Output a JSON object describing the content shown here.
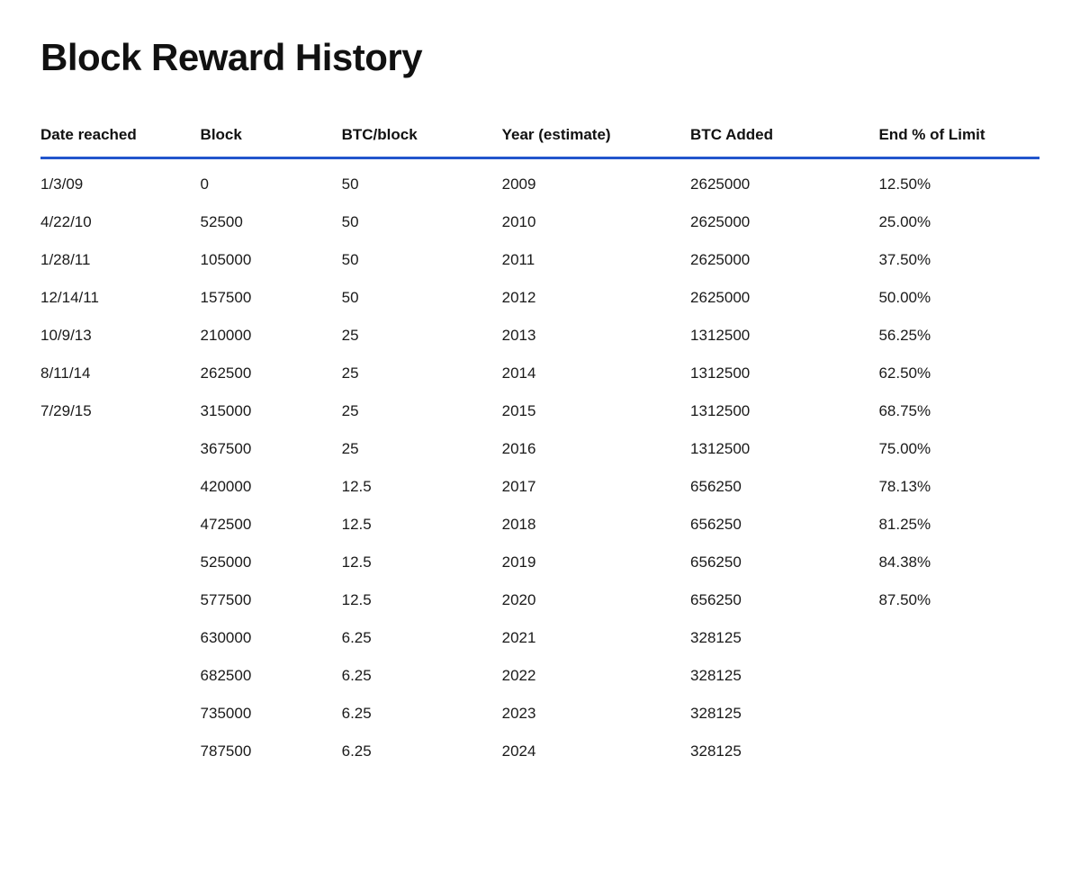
{
  "title": "Block Reward History",
  "table": {
    "headers": [
      {
        "key": "date",
        "label": "Date reached"
      },
      {
        "key": "block",
        "label": "Block"
      },
      {
        "key": "btcblock",
        "label": "BTC/block"
      },
      {
        "key": "year",
        "label": "Year (estimate)"
      },
      {
        "key": "btcadded",
        "label": "BTC Added"
      },
      {
        "key": "endlimit",
        "label": "End % of Limit"
      }
    ],
    "rows": [
      {
        "date": "1/3/09",
        "block": "0",
        "btcblock": "50",
        "year": "2009",
        "btcadded": "2625000",
        "endlimit": "12.50%"
      },
      {
        "date": "4/22/10",
        "block": "52500",
        "btcblock": "50",
        "year": "2010",
        "btcadded": "2625000",
        "endlimit": "25.00%"
      },
      {
        "date": "1/28/11",
        "block": "105000",
        "btcblock": "50",
        "year": "2011",
        "btcadded": "2625000",
        "endlimit": "37.50%"
      },
      {
        "date": "12/14/11",
        "block": "157500",
        "btcblock": "50",
        "year": "2012",
        "btcadded": "2625000",
        "endlimit": "50.00%"
      },
      {
        "date": "10/9/13",
        "block": "210000",
        "btcblock": "25",
        "year": "2013",
        "btcadded": "1312500",
        "endlimit": "56.25%"
      },
      {
        "date": "8/11/14",
        "block": "262500",
        "btcblock": "25",
        "year": "2014",
        "btcadded": "1312500",
        "endlimit": "62.50%"
      },
      {
        "date": "7/29/15",
        "block": "315000",
        "btcblock": "25",
        "year": "2015",
        "btcadded": "1312500",
        "endlimit": "68.75%"
      },
      {
        "date": "",
        "block": "367500",
        "btcblock": "25",
        "year": "2016",
        "btcadded": "1312500",
        "endlimit": "75.00%"
      },
      {
        "date": "",
        "block": "420000",
        "btcblock": "12.5",
        "year": "2017",
        "btcadded": "656250",
        "endlimit": "78.13%"
      },
      {
        "date": "",
        "block": "472500",
        "btcblock": "12.5",
        "year": "2018",
        "btcadded": "656250",
        "endlimit": "81.25%"
      },
      {
        "date": "",
        "block": "525000",
        "btcblock": "12.5",
        "year": "2019",
        "btcadded": "656250",
        "endlimit": "84.38%"
      },
      {
        "date": "",
        "block": "577500",
        "btcblock": "12.5",
        "year": "2020",
        "btcadded": "656250",
        "endlimit": "87.50%"
      },
      {
        "date": "",
        "block": "630000",
        "btcblock": "6.25",
        "year": "2021",
        "btcadded": "328125",
        "endlimit": ""
      },
      {
        "date": "",
        "block": "682500",
        "btcblock": "6.25",
        "year": "2022",
        "btcadded": "328125",
        "endlimit": ""
      },
      {
        "date": "",
        "block": "735000",
        "btcblock": "6.25",
        "year": "2023",
        "btcadded": "328125",
        "endlimit": ""
      },
      {
        "date": "",
        "block": "787500",
        "btcblock": "6.25",
        "year": "2024",
        "btcadded": "328125",
        "endlimit": ""
      }
    ]
  }
}
